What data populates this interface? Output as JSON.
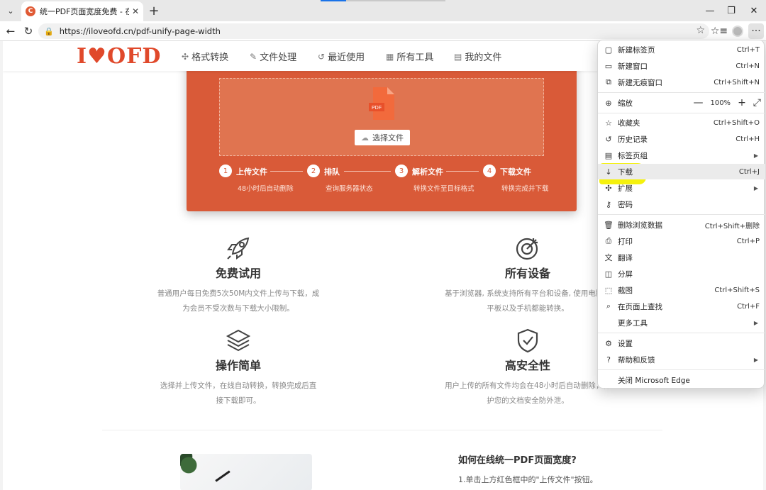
{
  "browser": {
    "tab": {
      "favicon_letter": "C",
      "title": "统一PDF页面宽度免费 - 在线统一PDF",
      "close": "✕"
    },
    "new_tab": "+",
    "window": {
      "minimize": "—",
      "restore": "❐",
      "close": "✕"
    },
    "address": {
      "url": "https://iloveofd.cn/pdf-unify-page-width"
    }
  },
  "site": {
    "logo": {
      "left": "I",
      "heart": "♥",
      "right": "OFD"
    },
    "nav": [
      {
        "icon": "puzzle-icon",
        "label": "格式转换"
      },
      {
        "icon": "file-edit-icon",
        "label": "文件处理"
      },
      {
        "icon": "history-icon",
        "label": "最近使用"
      },
      {
        "icon": "grid-icon",
        "label": "所有工具"
      },
      {
        "icon": "doc-icon",
        "label": "我的文件"
      }
    ],
    "upload": {
      "pdf_badge": "PDF",
      "select_button": "选择文件",
      "steps": [
        {
          "num": "1",
          "title": "上传文件",
          "sub": "48小时后自动删除"
        },
        {
          "num": "2",
          "title": "排队",
          "sub": "查询服务器状态"
        },
        {
          "num": "3",
          "title": "解析文件",
          "sub": "转换文件至目标格式"
        },
        {
          "num": "4",
          "title": "下载文件",
          "sub": "转换完成并下载"
        }
      ]
    },
    "features": [
      {
        "icon": "rocket-icon",
        "title": "免费试用",
        "desc1": "普通用户每日免费5次50M内文件上传与下载，成",
        "desc2": "为会员不受次数与下载大小限制。"
      },
      {
        "icon": "target-icon",
        "title": "所有设备",
        "desc1": "基于浏览器, 系统支持所有平台和设备, 使用电脑、",
        "desc2": "平板以及手机都能转换。"
      },
      {
        "icon": "layers-icon",
        "title": "操作简单",
        "desc1": "选择并上传文件，在线自动转换，转换完成后直",
        "desc2": "接下载即可。"
      },
      {
        "icon": "shield-check-icon",
        "title": "高安全性",
        "desc1": "用户上传的所有文件均会在48小时后自动删除，保",
        "desc2": "护您的文档安全防外泄。"
      }
    ],
    "howto": {
      "title": "如何在线统一PDF页面宽度?",
      "step1": "1.单击上方红色框中的\"上传文件\"按钮。"
    }
  },
  "menu": {
    "items": [
      {
        "key": "new-tab",
        "icon": "▢",
        "label": "新建标签页",
        "shortcut": "Ctrl+T"
      },
      {
        "key": "new-window",
        "icon": "▭",
        "label": "新建窗口",
        "shortcut": "Ctrl+N"
      },
      {
        "key": "new-inprivate",
        "icon": "⧉",
        "label": "新建无痕窗口",
        "shortcut": "Ctrl+Shift+N"
      },
      {
        "key": "zoom",
        "icon": "⊕",
        "label": "缩放",
        "zoom_minus": "—",
        "zoom_value": "100%",
        "zoom_plus": "+",
        "fullscreen": "⤢"
      },
      {
        "key": "favorites",
        "icon": "☆",
        "label": "收藏夹",
        "shortcut": "Ctrl+Shift+O"
      },
      {
        "key": "history",
        "icon": "↺",
        "label": "历史记录",
        "shortcut": "Ctrl+H"
      },
      {
        "key": "tab-groups",
        "icon": "▤",
        "label": "标签页组",
        "arrow": "▶"
      },
      {
        "key": "downloads",
        "icon": "↓",
        "label": "下载",
        "shortcut": "Ctrl+J"
      },
      {
        "key": "extensions",
        "icon": "✣",
        "label": "扩展",
        "arrow": "▶"
      },
      {
        "key": "passwords",
        "icon": "⚷",
        "label": "密码"
      },
      {
        "key": "clear-data",
        "icon": "🗑",
        "label": "删除浏览数据",
        "shortcut": "Ctrl+Shift+删除"
      },
      {
        "key": "print",
        "icon": "⎙",
        "label": "打印",
        "shortcut": "Ctrl+P"
      },
      {
        "key": "translate",
        "icon": "文",
        "label": "翻译"
      },
      {
        "key": "split-screen",
        "icon": "◫",
        "label": "分屏"
      },
      {
        "key": "screenshot",
        "icon": "⬚",
        "label": "截图",
        "shortcut": "Ctrl+Shift+S"
      },
      {
        "key": "find",
        "icon": "⌕",
        "label": "在页面上查找",
        "shortcut": "Ctrl+F"
      },
      {
        "key": "more-tools",
        "icon": "",
        "label": "更多工具",
        "arrow": "▶"
      },
      {
        "key": "settings",
        "icon": "⚙",
        "label": "设置"
      },
      {
        "key": "help",
        "icon": "?",
        "label": "帮助和反馈",
        "arrow": "▶"
      },
      {
        "key": "close-edge",
        "icon": "",
        "label": "关闭 Microsoft Edge"
      }
    ]
  }
}
